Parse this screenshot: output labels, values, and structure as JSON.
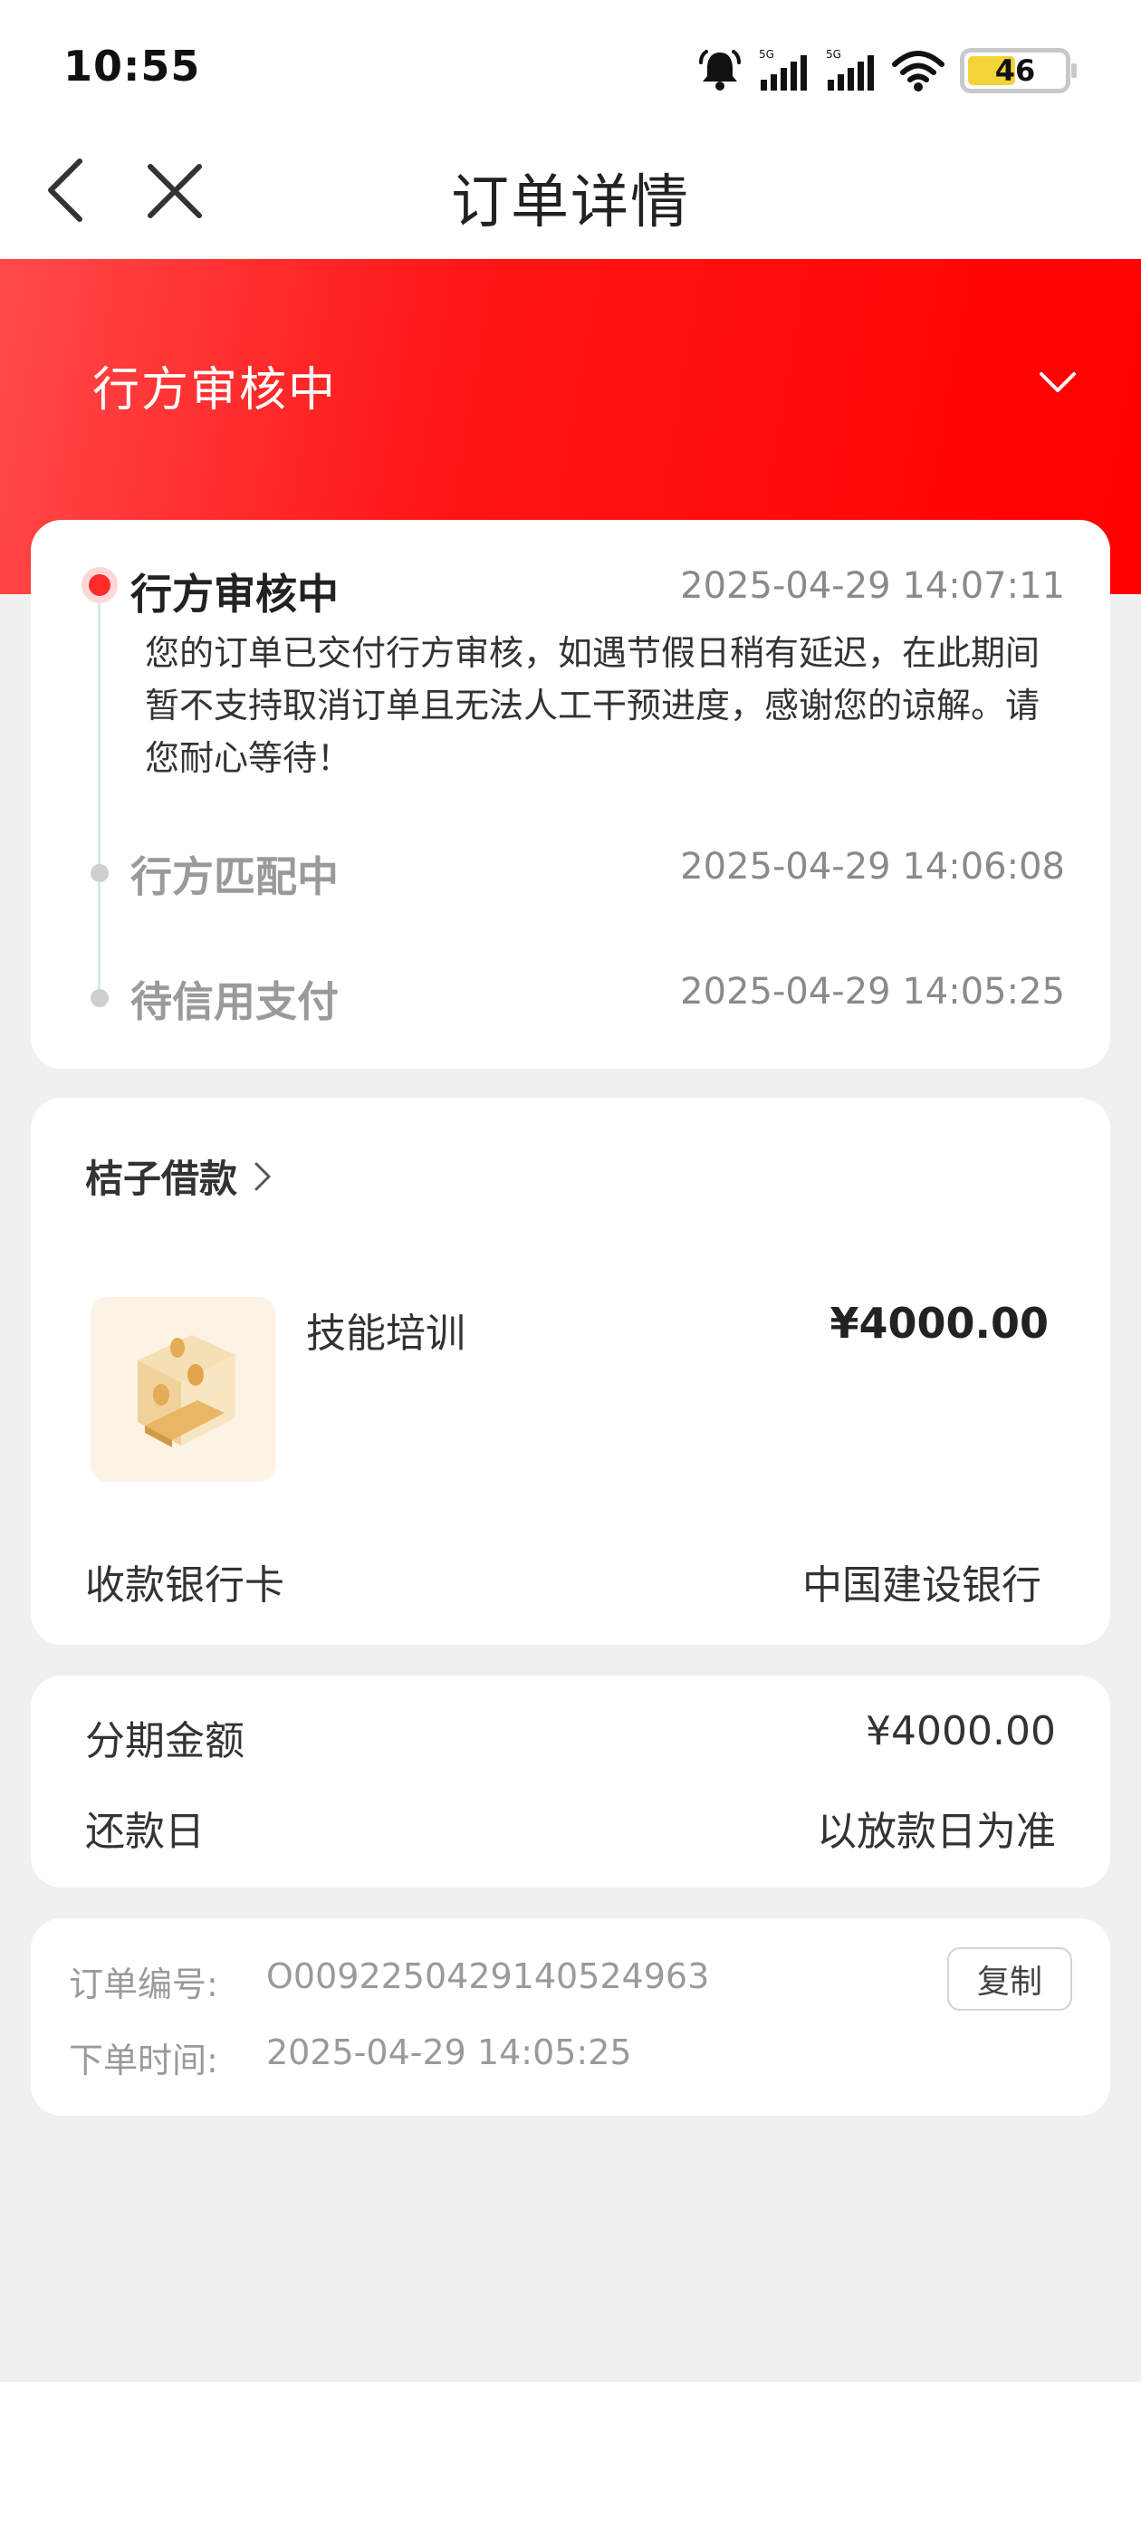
{
  "status_bar": {
    "time": "10:55",
    "signal1_label": "5G",
    "signal2_label": "5G",
    "battery": "46",
    "icons": [
      "bell-icon",
      "signal-icon",
      "signal-icon",
      "wifi-icon",
      "battery-icon"
    ]
  },
  "nav": {
    "title": "订单详情",
    "back_icon": "chevron-left-icon",
    "close_icon": "close-icon"
  },
  "banner": {
    "title": "行方审核中",
    "expand_icon": "chevron-down-icon"
  },
  "timeline": {
    "items": [
      {
        "title": "行方审核中",
        "time": "2025-04-29 14:07:11",
        "description": "您的订单已交付行方审核，如遇节假日稍有延迟，在此期间暂不支持取消订单且无法人工干预进度，感谢您的谅解。请您耐心等待！"
      },
      {
        "title": "行方匹配中",
        "time": "2025-04-29 14:06:08"
      },
      {
        "title": "待信用支付",
        "time": "2025-04-29 14:05:25"
      }
    ]
  },
  "product": {
    "merchant": "桔子借款",
    "name": "技能培训",
    "price": "¥4000.00",
    "bank_label": "收款银行卡",
    "bank_value": "中国建设银行"
  },
  "amount": {
    "installment_label": "分期金额",
    "installment_value": "¥4000.00",
    "repay_label": "还款日",
    "repay_value": "以放款日为准"
  },
  "order": {
    "number_label": "订单编号:",
    "number_value": "O0092250429140524963",
    "copy_label": "复制",
    "time_label": "下单时间:",
    "time_value": "2025-04-29 14:05:25"
  },
  "colors": {
    "brand_red": "#ff0000",
    "active_dot": "#ff2a2a",
    "page_bg": "#f0f0f0"
  }
}
